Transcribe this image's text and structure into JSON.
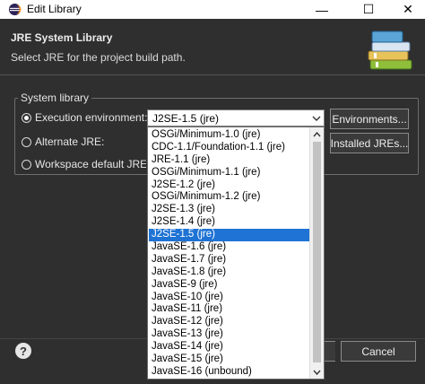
{
  "window": {
    "title": "Edit Library",
    "minimize_glyph": "—",
    "maximize_glyph": "☐",
    "close_glyph": "✕",
    "icon": "eclipse-icon"
  },
  "header": {
    "title": "JRE System Library",
    "description": "Select JRE for the project build path.",
    "icon": "library-books-icon"
  },
  "group": {
    "title": "System library",
    "options": [
      {
        "label": "Execution environment:",
        "checked": true
      },
      {
        "label": "Alternate JRE:",
        "checked": false
      },
      {
        "label": "Workspace default JRE (jre)",
        "checked": false
      }
    ]
  },
  "combo": {
    "selected": "J2SE-1.5 (jre)"
  },
  "buttons": {
    "environments": "Environments...",
    "installed_jres": "Installed JREs...",
    "cancel": "Cancel"
  },
  "dropdown": {
    "items": [
      "OSGi/Minimum-1.0 (jre)",
      "CDC-1.1/Foundation-1.1 (jre)",
      "JRE-1.1 (jre)",
      "OSGi/Minimum-1.1 (jre)",
      "J2SE-1.2 (jre)",
      "OSGi/Minimum-1.2 (jre)",
      "J2SE-1.3 (jre)",
      "J2SE-1.4 (jre)",
      "J2SE-1.5 (jre)",
      "JavaSE-1.6 (jre)",
      "JavaSE-1.7 (jre)",
      "JavaSE-1.8 (jre)",
      "JavaSE-9 (jre)",
      "JavaSE-10 (jre)",
      "JavaSE-11 (jre)",
      "JavaSE-12 (jre)",
      "JavaSE-13 (jre)",
      "JavaSE-14 (jre)",
      "JavaSE-15 (jre)",
      "JavaSE-16 (unbound)"
    ],
    "selected_index": 8
  },
  "footer": {
    "help_glyph": "?"
  },
  "colors": {
    "background": "#2f2f2f",
    "selection": "#1e73d4",
    "titlebar": "#ffffff"
  }
}
